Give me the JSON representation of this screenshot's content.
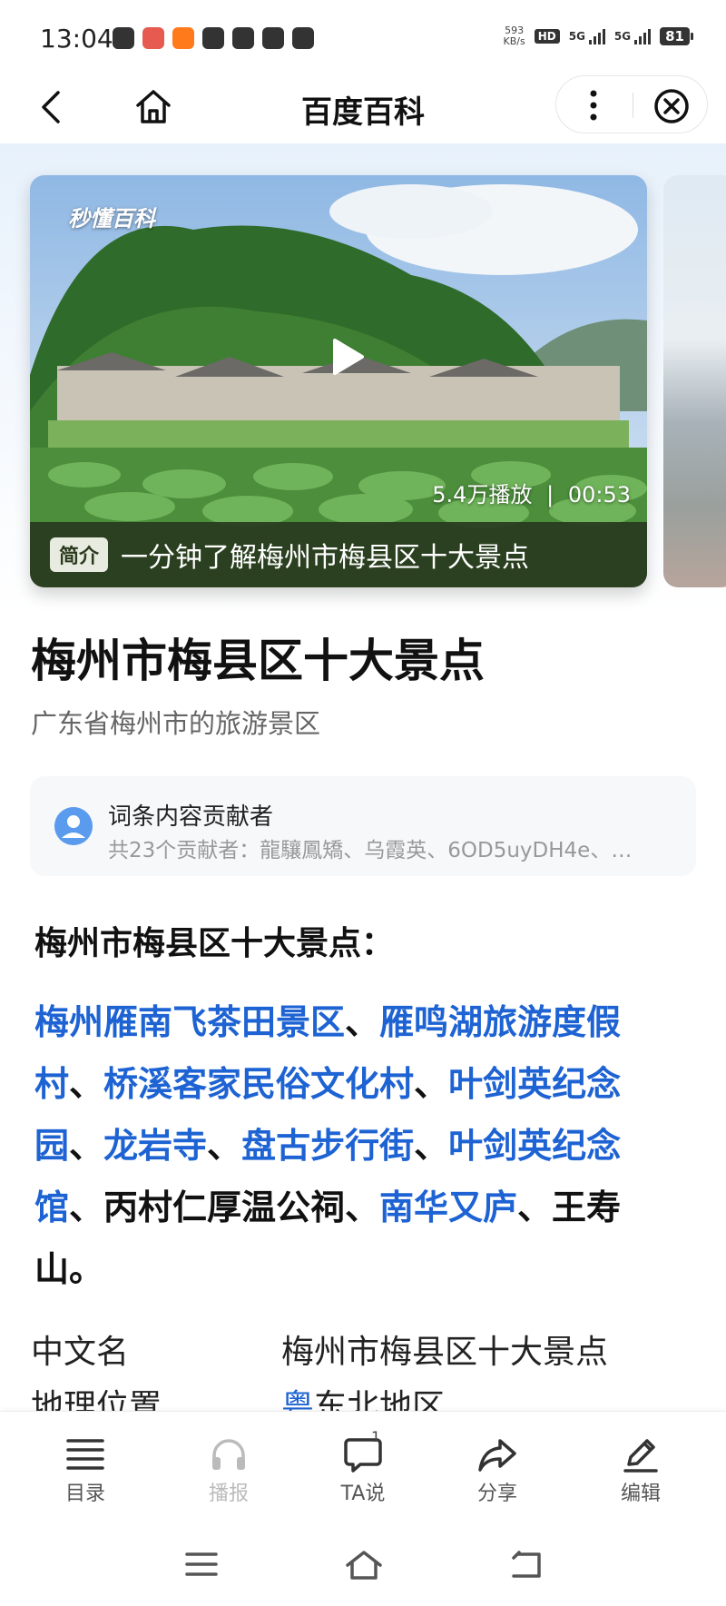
{
  "status_bar": {
    "time": "13:04",
    "net_speed_value": "593",
    "net_speed_unit": "KB/s",
    "hd_label": "HD",
    "sim1_label": "5G",
    "sim2_label": "5G",
    "battery": "81"
  },
  "navbar": {
    "title": "百度百科"
  },
  "video": {
    "logo_text": "秒懂百科",
    "views": "5.4万播放",
    "duration": "00:53",
    "stats_separator": "|",
    "tag": "简介",
    "caption": "一分钟了解梅州市梅县区十大景点"
  },
  "article": {
    "title": "梅州市梅县区十大景点",
    "subtitle": "广东省梅州市的旅游景区",
    "contributors": {
      "title": "词条内容贡献者",
      "summary": "共23个贡献者：龍驤鳳矯、乌霞英、6OD5uyDH4e、…"
    },
    "section_heading": "梅州市梅县区十大景点：",
    "spots": [
      {
        "text": "梅州雁南飞茶田景区",
        "link": true
      },
      {
        "text": "、",
        "link": false
      },
      {
        "text": "雁鸣湖旅游度假村",
        "link": true
      },
      {
        "text": "、",
        "link": false
      },
      {
        "text": "桥溪客家民俗文化村",
        "link": true
      },
      {
        "text": "、",
        "link": false
      },
      {
        "text": "叶剑英纪念园",
        "link": true
      },
      {
        "text": "、",
        "link": false
      },
      {
        "text": "龙岩寺",
        "link": true
      },
      {
        "text": "、",
        "link": false
      },
      {
        "text": "盘古步行街",
        "link": true
      },
      {
        "text": "、",
        "link": false
      },
      {
        "text": "叶剑英纪念馆",
        "link": true
      },
      {
        "text": "、丙村仁厚温公祠、",
        "link": false
      },
      {
        "text": "南华又庐",
        "link": true
      },
      {
        "text": "、王寿山。",
        "link": false
      }
    ],
    "infobox": {
      "row1_label": "中文名",
      "row1_value": "梅州市梅县区十大景点",
      "row2_label": "地理位置",
      "row2_value_link": "粤",
      "row2_value_rest": "东北地区"
    }
  },
  "bottom_bar": {
    "toc": "目录",
    "broadcast": "播报",
    "ta_say": "TA说",
    "ta_say_badge": "1",
    "share": "分享",
    "edit": "编辑"
  }
}
